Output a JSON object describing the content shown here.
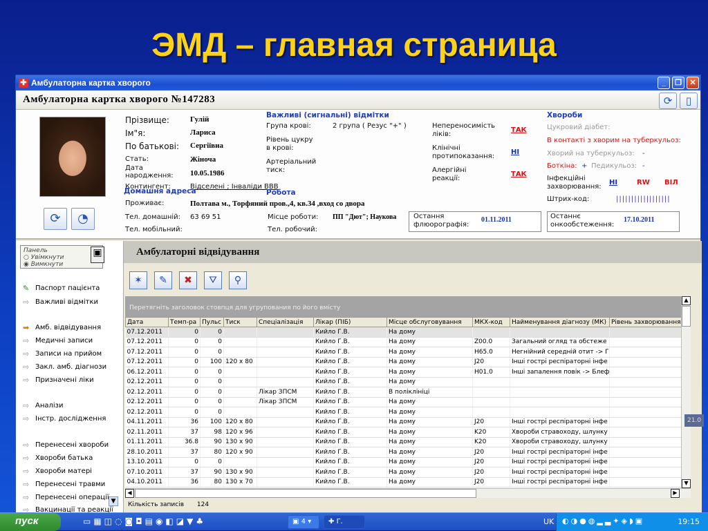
{
  "slide_title": "ЭМД – главная страница",
  "window": {
    "title": "Амбулаторна картка хворого"
  },
  "card_header": "Амбулаторна картка хворого №147283",
  "patient": {
    "surname_label": "Прізвище:",
    "surname": "Гулій",
    "name_label": "Ім\"я:",
    "name": "Лариса",
    "patronymic_label": "По батькові:",
    "patronymic": "Сергіївна",
    "sex_label": "Стать:",
    "sex": "Жіноча",
    "dob_label_1": "Дата",
    "dob_label_2": "народження:",
    "dob": "10.05.1986",
    "contingent_label": "Контингент:",
    "contingent": "Відселені ; Інваліди ВВВ"
  },
  "important": {
    "title": "Важливі (сигнальні) відмітки",
    "blood_label": "Група крові:",
    "blood": "2 група ( Резус \"+\" )",
    "sugar_label_1": "Рівень цукру",
    "sugar_label_2": "в крові:",
    "pressure_label_1": "Артеріальний",
    "pressure_label_2": "тиск:",
    "intolerance_label_1": "Непереносимість",
    "intolerance_label_2": "ліків:",
    "intolerance": "ТАК",
    "contra_label_1": "Клінічні",
    "contra_label_2": "протипоказання:",
    "contra": "НІ",
    "allergy_label_1": "Алергійні",
    "allergy_label_2": "реакції:",
    "allergy": "ТАК"
  },
  "diseases": {
    "title": "Хвороби",
    "diabetes": "Цукровий діабет:",
    "tb_contact": "В контакті з хворим на туберкульоз:",
    "tb": "Хворий на туберкульоз:",
    "tb_val": "-",
    "botkin": "Боткіна:",
    "botkin_val": "+",
    "lice": "Педикульоз:",
    "lice_val": "-",
    "infect_1": "Інфекційні",
    "infect_2": "захворювання:",
    "infect_ni": "НІ",
    "infect_rw": "RW",
    "infect_vil": "ВІЛ",
    "barcode_label": "Штрих-код:",
    "barcode": "||||||||||||||||||"
  },
  "address": {
    "title": "Домашня адреса",
    "lives_label": "Проживає:",
    "lives": "Полтава м., Торфяний пров.,4, кв.34 ,вход со двора",
    "phone_home_label": "Тел. домашній:",
    "phone_home": "63 69 51",
    "phone_mobile_label": "Тел. мобільний:"
  },
  "work": {
    "title": "Робота",
    "place_label": "Місце роботи:",
    "place": "ПП \"Дют\"; Наукова",
    "phone_label": "Тел. робочий:"
  },
  "fluoro": {
    "label_1": "Остання",
    "label_2": "флюорографія:",
    "date": "01.11.2011"
  },
  "onco": {
    "label_1": "Останнє",
    "label_2": "онкообстеження:",
    "date": "17.10.2011"
  },
  "panel": {
    "title": "Панель",
    "on": "Увімкнути",
    "off": "Вимкнути",
    "items": [
      "Паспорт пацієнта",
      "Важливі відмітки",
      "Амб. відвідування",
      "Медичні записи",
      "Записи на прийом",
      "Закл. амб. діагнози",
      "Призначені ліки",
      "Аналізи",
      "Інстр. дослідження",
      "Перенесені хвороби",
      "Хвороби батька",
      "Хвороби матері",
      "Перенесені травми",
      "Перенесені операції",
      "Вакцинації та реакції"
    ]
  },
  "visits": {
    "title": "Амбулаторні відвідування",
    "group_hint": "Перетягніть заголовок стовпця для угрупования по його вмісту",
    "columns": [
      "Дата",
      "Темп-ра",
      "Пульс",
      "Тиск",
      "Спеціалізація",
      "Лікар (ПІБ)",
      "Місце обслуговування",
      "МКХ-код",
      "Найменування діагнозу (МК)",
      "Рівень захворювання"
    ],
    "rows": [
      [
        "07.12.2011",
        "0",
        "0",
        "",
        "",
        "Кийло Г.В.",
        "На дому",
        "",
        "",
        ""
      ],
      [
        "07.12.2011",
        "0",
        "0",
        "",
        "",
        "Кийло Г.В.",
        "На дому",
        "Z00.0",
        "Загальний огляд та обстеже",
        ""
      ],
      [
        "07.12.2011",
        "0",
        "0",
        "",
        "",
        "Кийло Г.В.",
        "На дому",
        "H65.0",
        "Негнійний середній отит -> Г",
        ""
      ],
      [
        "07.12.2011",
        "0",
        "100",
        "120 х 80",
        "",
        "Кийло Г.В.",
        "На дому",
        "J20",
        "Інші гострі респіраторні інфе",
        ""
      ],
      [
        "06.12.2011",
        "0",
        "0",
        "",
        "",
        "Кийло Г.В.",
        "На дому",
        "H01.0",
        "Інші запалення повік -> Блеф",
        ""
      ],
      [
        "02.12.2011",
        "0",
        "0",
        "",
        "",
        "Кийло Г.В.",
        "На дому",
        "",
        "",
        ""
      ],
      [
        "02.12.2011",
        "0",
        "0",
        "",
        "Лікар ЗПСМ",
        "Кийло Г.В.",
        "В поліклініці",
        "",
        "",
        ""
      ],
      [
        "02.12.2011",
        "0",
        "0",
        "",
        "Лікар ЗПСМ",
        "Кийло Г.В.",
        "На дому",
        "",
        "",
        ""
      ],
      [
        "02.12.2011",
        "0",
        "0",
        "",
        "",
        "Кийло Г.В.",
        "На дому",
        "",
        "",
        ""
      ],
      [
        "04.11.2011",
        "36",
        "100",
        "120 х 80",
        "",
        "Кийло Г.В.",
        "На дому",
        "J20",
        "Інші гострі респіраторні інфе",
        ""
      ],
      [
        "02.11.2011",
        "37",
        "98",
        "120 х 96",
        "",
        "Кийло Г.В.",
        "На дому",
        "K20",
        "Хвороби стравоходу, шлунку",
        ""
      ],
      [
        "01.11.2011",
        "36.8",
        "90",
        "130 х 90",
        "",
        "Кийло Г.В.",
        "На дому",
        "K20",
        "Хвороби стравоходу, шлунку",
        ""
      ],
      [
        "28.10.2011",
        "37",
        "80",
        "120 х 90",
        "",
        "Кийло Г.В.",
        "На дому",
        "J20",
        "Інші гострі респіраторні інфе",
        ""
      ],
      [
        "13.10.2011",
        "0",
        "0",
        "",
        "",
        "Кийло Г.В.",
        "На дому",
        "J20",
        "Інші гострі респіраторні інфе",
        ""
      ],
      [
        "07.10.2011",
        "37",
        "90",
        "130 х 90",
        "",
        "Кийло Г.В.",
        "На дому",
        "J20",
        "Інші гострі респіраторні інфе",
        ""
      ],
      [
        "04.10.2011",
        "36",
        "80",
        "130 х 70",
        "",
        "Кийло Г.В.",
        "На дому",
        "J20",
        "Інші гострі респіраторні інфе",
        ""
      ]
    ],
    "count_label": "Кількість записів",
    "count": "124"
  },
  "side_badge": "21.0",
  "taskbar": {
    "start": "пуск",
    "task1": "4",
    "task2": "Г.",
    "lang": "UK",
    "clock": "19:15"
  }
}
